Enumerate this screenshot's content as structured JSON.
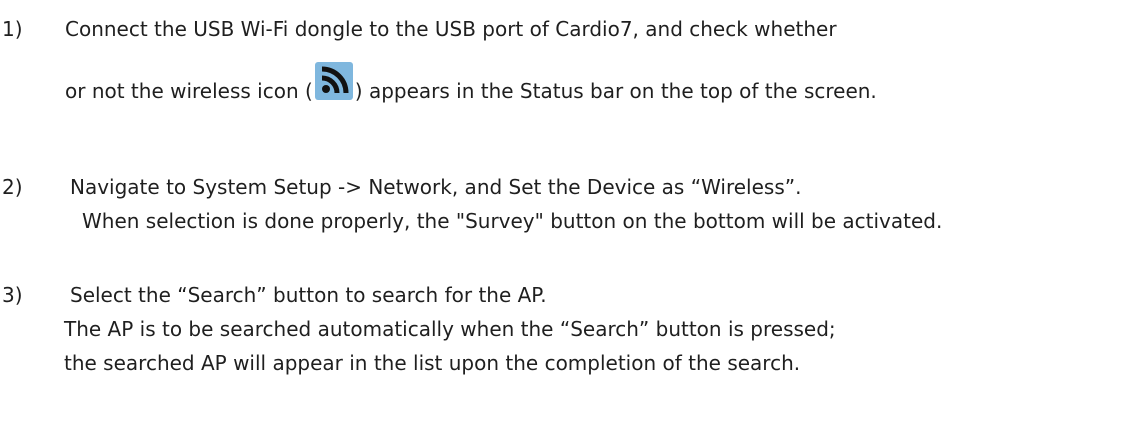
{
  "steps": [
    {
      "number": "1)",
      "line1": "Connect the USB Wi-Fi dongle to the USB port of Cardio7, and check whether",
      "line2_before": "or not the wireless icon (",
      "line2_icon": "wireless-icon",
      "line2_after": ") appears in the Status bar on the top of the screen."
    },
    {
      "number": "2)",
      "line1": "Navigate to System Setup -> Network, and Set the Device as “Wireless”.",
      "line2": "When selection is done properly, the \"Survey\" button on the bottom will be activated."
    },
    {
      "number": "3)",
      "line1": "Select the “Search” button to search for the AP.",
      "line2": "The AP is to be searched automatically when the “Search” button is pressed;",
      "line3": "the searched AP will appear in the list upon the completion of the search."
    }
  ],
  "colors": {
    "icon_bg": "#7fb7de",
    "icon_fg": "#111111"
  }
}
